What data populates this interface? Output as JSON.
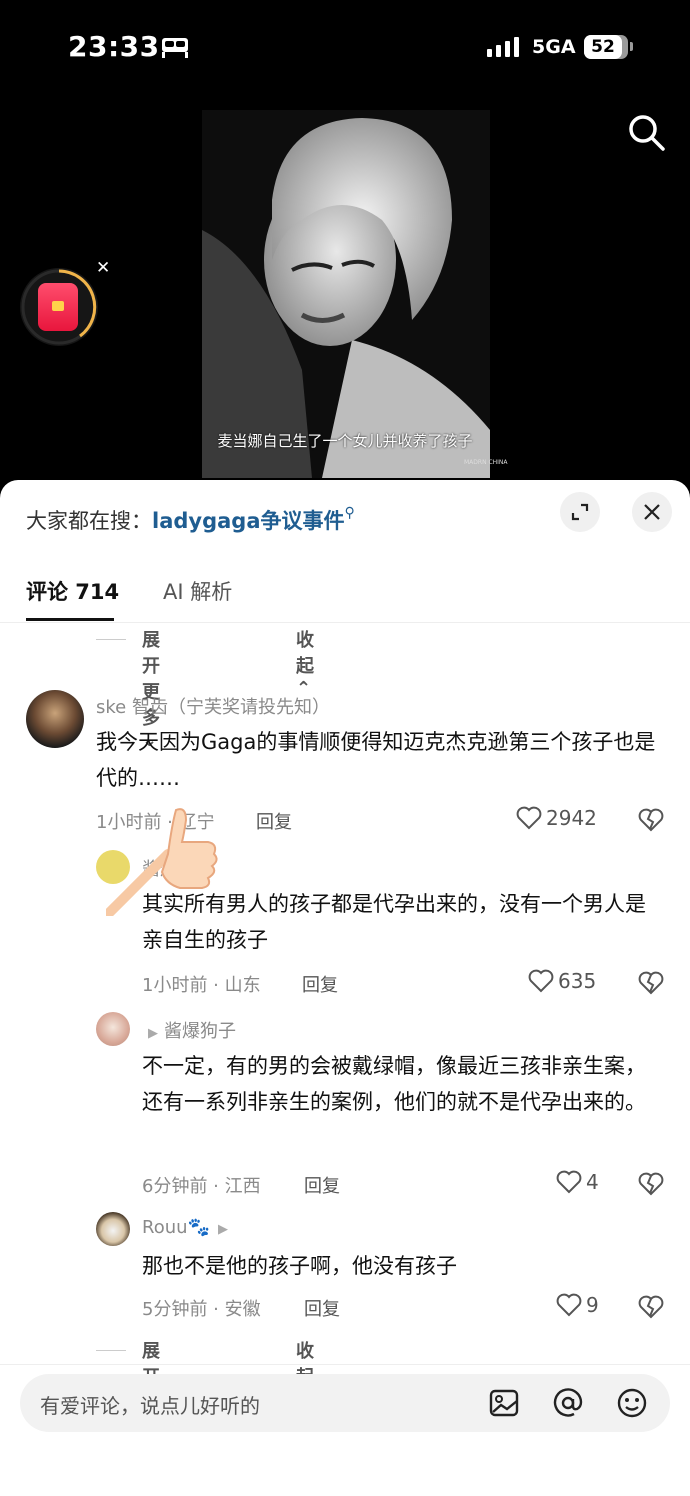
{
  "status_bar": {
    "time": "23:33",
    "network": "5GA",
    "battery": "52"
  },
  "video": {
    "subtitle": "麦当娜自己生了一个女儿并收养了孩子",
    "watermark": "MADRN CHINA"
  },
  "sheet": {
    "hot_search_prefix": "大家都在搜：",
    "hot_search_keyword": "ladygaga争议事件",
    "tabs": [
      {
        "label": "评论 714"
      },
      {
        "label": "AI 解析"
      }
    ],
    "expand_label": "展开更多",
    "collapse_label": "收起"
  },
  "comments": [
    {
      "username": "ske 智齿（宁芙奖请投先知）",
      "text": "我今天因为Gaga的事情顺便得知迈克杰克逊第三个孩子也是代的……",
      "time_location": "1小时前 · 辽宁",
      "reply_label": "回复",
      "likes": "2942"
    },
    {
      "username": "酱爆狗子",
      "text": "其实所有男人的孩子都是代孕出来的，没有一个男人是亲自生的孩子",
      "time_location": "1小时前 · 山东",
      "reply_label": "回复",
      "likes": "635"
    },
    {
      "reply_to": "酱爆狗子",
      "text": "不一定，有的男的会被戴绿帽，像最近三孩非亲生案，还有一系列非亲生的案例，他们的就不是代孕出来的。",
      "time_location": "6分钟前 · 江西",
      "reply_label": "回复",
      "likes": "4"
    },
    {
      "username": "Rouu🐾",
      "text": "那也不是他的孩子啊，他没有孩子",
      "time_location": "5分钟前 · 安徽",
      "reply_label": "回复",
      "likes": "9"
    }
  ],
  "input": {
    "placeholder": "有爱评论，说点儿好听的"
  },
  "icons": [
    "bed-icon",
    "signal-icon",
    "search-icon",
    "red-packet-icon",
    "close-icon",
    "expand-icon",
    "heart-icon",
    "dislike-icon",
    "thumbs-up-icon",
    "image-icon",
    "at-icon",
    "emoji-icon"
  ]
}
